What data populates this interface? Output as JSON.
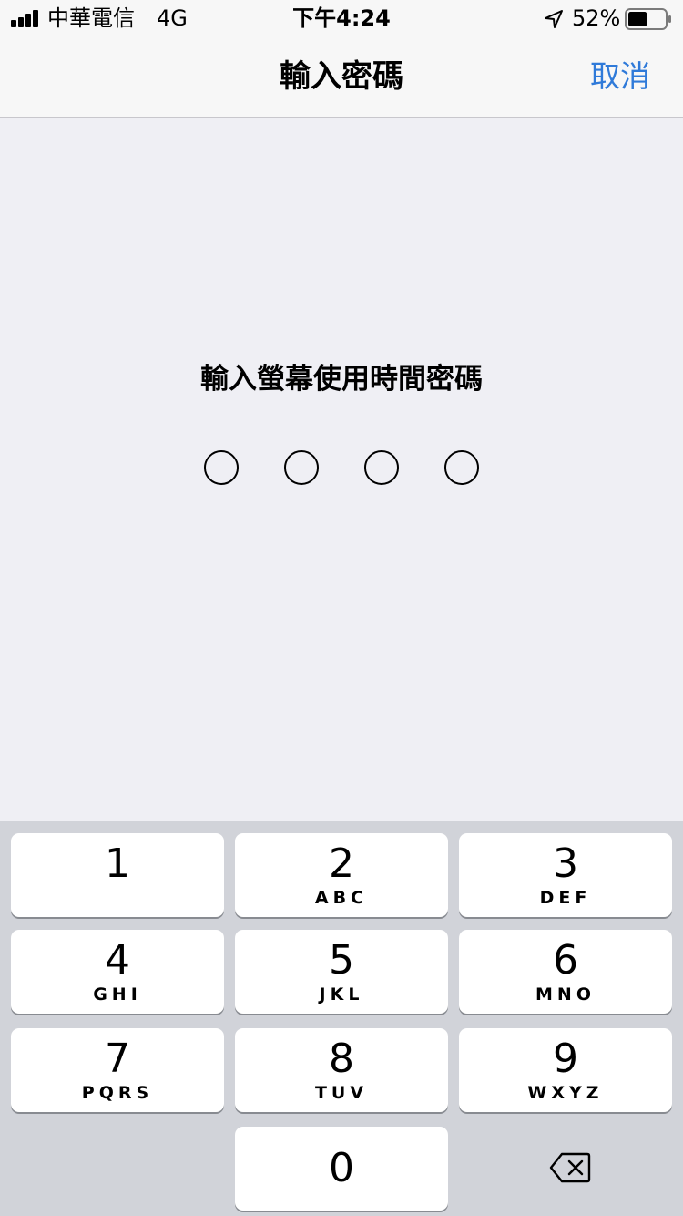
{
  "status_bar": {
    "carrier": "中華電信",
    "network": "4G",
    "time": "下午4:24",
    "battery_percent": "52%",
    "battery_level": 0.52
  },
  "nav": {
    "title": "輸入密碼",
    "cancel_label": "取消"
  },
  "prompt": {
    "text": "輸入螢幕使用時間密碼",
    "digits_entered": 0,
    "digits_total": 4
  },
  "keypad": {
    "keys": [
      {
        "digit": "1",
        "letters": ""
      },
      {
        "digit": "2",
        "letters": "ABC"
      },
      {
        "digit": "3",
        "letters": "DEF"
      },
      {
        "digit": "4",
        "letters": "GHI"
      },
      {
        "digit": "5",
        "letters": "JKL"
      },
      {
        "digit": "6",
        "letters": "MNO"
      },
      {
        "digit": "7",
        "letters": "PQRS"
      },
      {
        "digit": "8",
        "letters": "TUV"
      },
      {
        "digit": "9",
        "letters": "WXYZ"
      },
      {
        "digit": "0",
        "letters": ""
      }
    ],
    "delete_icon": "delete-backspace-icon"
  },
  "colors": {
    "accent": "#2f7ad9",
    "background": "#efeff4",
    "keypad_background": "#d1d3d9"
  }
}
